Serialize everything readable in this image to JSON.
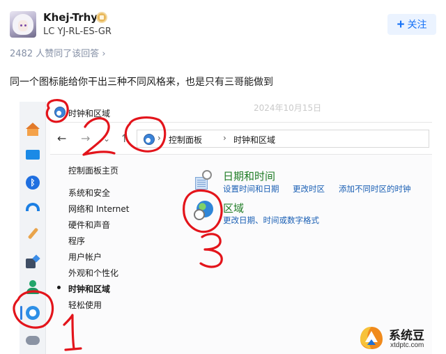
{
  "author": {
    "name": "Khej-Trhyk",
    "bio": "LC YJ-RL-ES-GR",
    "follow_label": "关注",
    "follow_plus": "+"
  },
  "likes_text": "2482 人赞同了该回答 ›",
  "post_text": "同一个图标能给你干出三种不同风格来，也是只有三哥能做到",
  "screenshot": {
    "window_title": "时钟和区域",
    "ghost_date": "2024年10月15日",
    "nav": {
      "back": "←",
      "forward": "→",
      "dropdown": "⌄",
      "up": "↑"
    },
    "address": {
      "sep": "›",
      "seg1": "控制面板",
      "seg2": "时钟和区域"
    },
    "left_nav": {
      "home": "控制面板主页",
      "items": [
        "系统和安全",
        "网络和 Internet",
        "硬件和声音",
        "程序",
        "用户帐户",
        "外观和个性化",
        "时钟和区域",
        "轻松使用"
      ]
    },
    "categories": [
      {
        "title": "日期和时间",
        "links": [
          "设置时间和日期",
          "更改时区",
          "添加不同时区的时钟"
        ]
      },
      {
        "title": "区域",
        "links": [
          "更改日期、时间或数字格式"
        ]
      }
    ]
  },
  "annotations": [
    "1",
    "2",
    "3"
  ],
  "watermark": {
    "title": "系统豆",
    "url": "xtdptc.com"
  },
  "colors": {
    "accent": "#1772f6",
    "annotation": "#e3141b",
    "category_title": "#1e7c24",
    "link": "#1a5fb4"
  }
}
